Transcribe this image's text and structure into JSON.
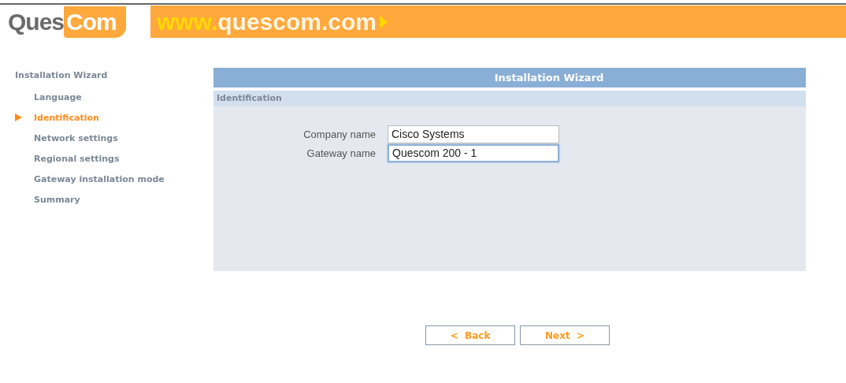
{
  "header": {
    "logo": {
      "part_1": "Ques",
      "part_2": "Com"
    },
    "banner": {
      "part_1": "www.",
      "part_2": "quescom.com"
    }
  },
  "sidebar": {
    "title": "Installation Wizard",
    "items": [
      {
        "label": "Language",
        "selected": false
      },
      {
        "label": "Identification",
        "selected": true
      },
      {
        "label": "Network settings",
        "selected": false
      },
      {
        "label": "Regional settings",
        "selected": false
      },
      {
        "label": "Gateway installation mode",
        "selected": false
      },
      {
        "label": "Summary",
        "selected": false
      }
    ]
  },
  "panel": {
    "title": "Installation Wizard",
    "section": "Identification",
    "fields": [
      {
        "label": "Company name",
        "value": "Cisco Systems",
        "focused": false
      },
      {
        "label": "Gateway name",
        "value": "Quescom 200 - 1",
        "focused": true
      }
    ]
  },
  "buttons": [
    {
      "label": "<  Back"
    },
    {
      "label": "Next  >"
    }
  ]
}
